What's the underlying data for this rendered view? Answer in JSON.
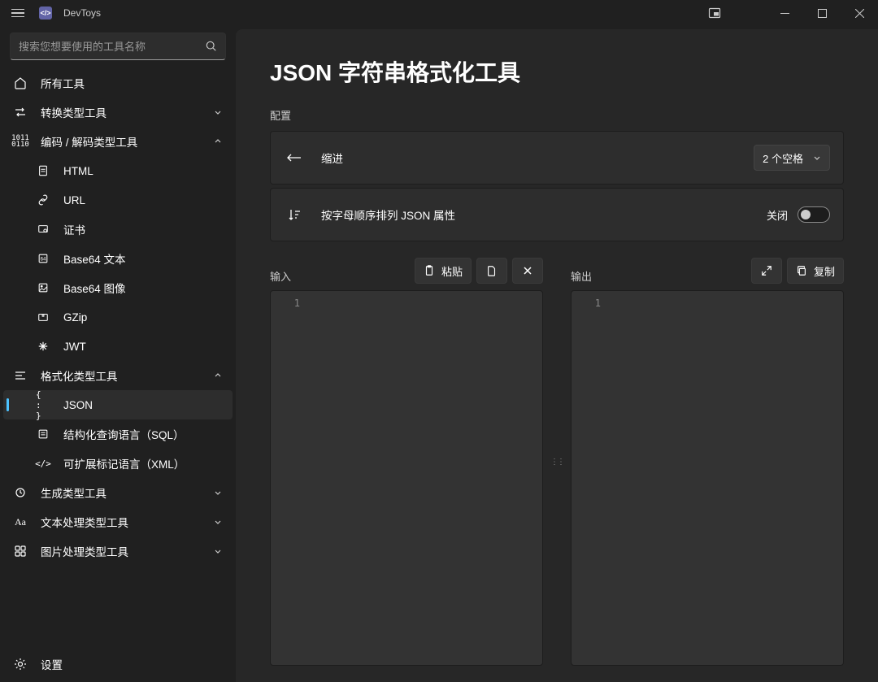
{
  "app": {
    "title": "DevToys"
  },
  "search": {
    "placeholder": "搜索您想要使用的工具名称"
  },
  "nav": {
    "all_tools": "所有工具",
    "converters": "转换类型工具",
    "encoders": "编码 / 解码类型工具",
    "encoders_items": {
      "html": "HTML",
      "url": "URL",
      "cert": "证书",
      "base64text": "Base64 文本",
      "base64image": "Base64 图像",
      "gzip": "GZip",
      "jwt": "JWT"
    },
    "formatters": "格式化类型工具",
    "formatters_items": {
      "json": "JSON",
      "sql": "结构化查询语言（SQL）",
      "xml": "可扩展标记语言（XML）"
    },
    "generators": "生成类型工具",
    "text": "文本处理类型工具",
    "graphic": "图片处理类型工具",
    "settings": "设置"
  },
  "page": {
    "title": "JSON 字符串格式化工具",
    "config_label": "配置",
    "indent_label": "缩进",
    "indent_value": "2 个空格",
    "sort_label": "按字母顺序排列 JSON 属性",
    "sort_state": "关闭",
    "input_label": "输入",
    "output_label": "输出",
    "paste_label": "粘贴",
    "copy_label": "复制",
    "line_number": "1"
  }
}
